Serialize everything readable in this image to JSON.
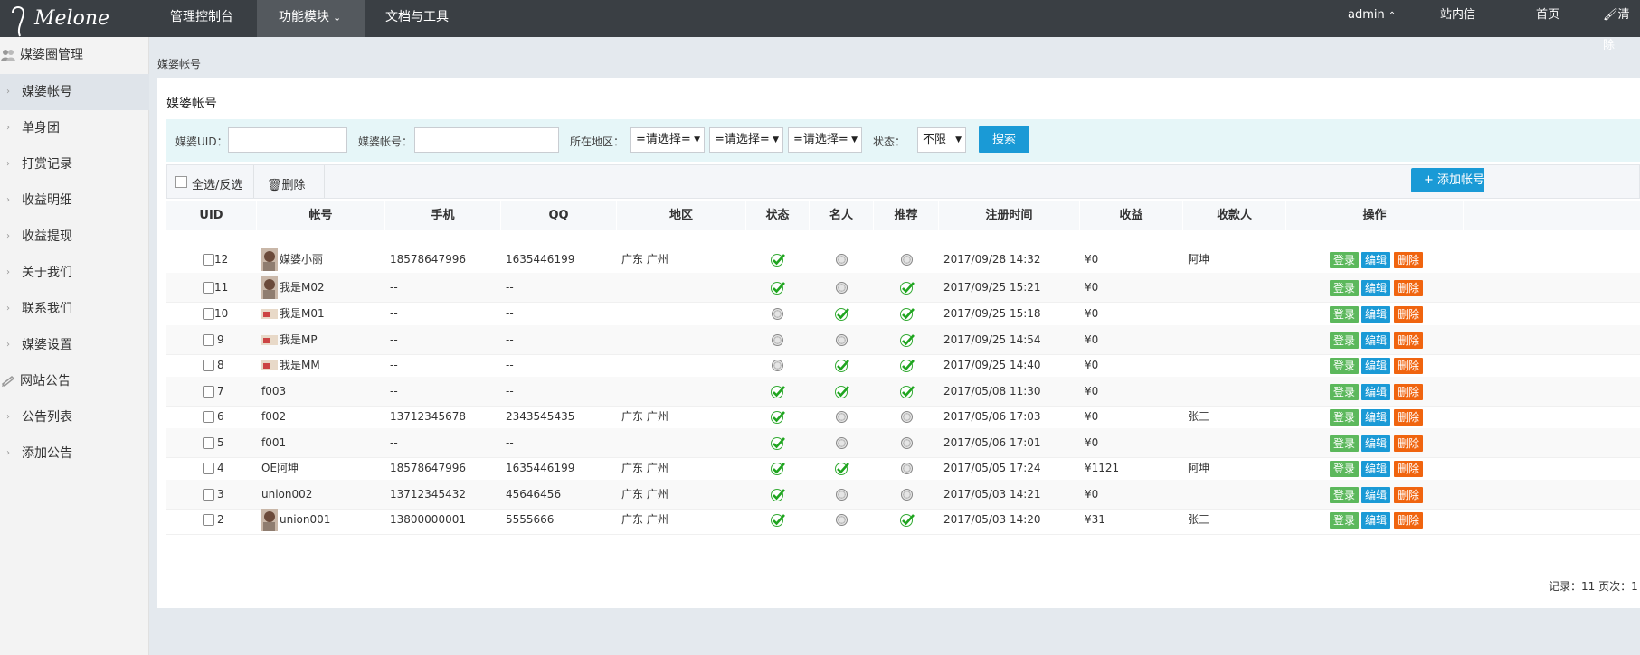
{
  "brand": {
    "logo_text": "Melone"
  },
  "topnav": {
    "items": [
      "管理控制台",
      "功能模块",
      "文档与工具"
    ],
    "user": "admin",
    "messages": "站内信",
    "home": "首页",
    "clear": "清除"
  },
  "sidebar": {
    "group1": "媒婆圈管理",
    "group1_items": [
      "媒婆帐号",
      "单身团",
      "打赏记录",
      "收益明细",
      "收益提现",
      "关于我们",
      "联系我们",
      "媒婆设置"
    ],
    "group2": "网站公告",
    "group2_items": [
      "公告列表",
      "添加公告"
    ]
  },
  "breadcrumb": "媒婆帐号",
  "panel_title": "媒婆帐号",
  "filter": {
    "uid_label": "媒婆UID：",
    "account_label": "媒婆帐号：",
    "region_label": "所在地区：",
    "select_default": "=请选择=",
    "status_label": "状态：",
    "status_value": "不限",
    "search_button": "搜索"
  },
  "toolbar": {
    "select_all": "全选/反选",
    "delete": "删除",
    "add": "+ 添加帐号"
  },
  "table": {
    "headers": [
      "UID",
      "帐号",
      "手机",
      "QQ",
      "地区",
      "状态",
      "名人",
      "推荐",
      "注册时间",
      "收益",
      "收款人",
      "操作"
    ],
    "action_labels": {
      "login": "登录",
      "edit": "编辑",
      "delete": "删除"
    },
    "rows": [
      {
        "uid": "12",
        "account": "媒婆小丽",
        "avatar": "photo",
        "phone": "18578647996",
        "qq": "1635446199",
        "region": "广东 广州",
        "status": true,
        "celebrity": false,
        "recommend": false,
        "time": "2017/09/28 14:32",
        "income": "¥0",
        "payee": "阿坤"
      },
      {
        "uid": "11",
        "account": "我是M02",
        "avatar": "photo",
        "phone": "--",
        "qq": "--",
        "region": "",
        "status": true,
        "celebrity": false,
        "recommend": true,
        "time": "2017/09/25 15:21",
        "income": "¥0",
        "payee": ""
      },
      {
        "uid": "10",
        "account": "我是M01",
        "avatar": "thumb",
        "phone": "--",
        "qq": "--",
        "region": "",
        "status": false,
        "celebrity": true,
        "recommend": true,
        "time": "2017/09/25 15:18",
        "income": "¥0",
        "payee": ""
      },
      {
        "uid": "9",
        "account": "我是MP",
        "avatar": "thumb",
        "phone": "--",
        "qq": "--",
        "region": "",
        "status": false,
        "celebrity": false,
        "recommend": true,
        "time": "2017/09/25 14:54",
        "income": "¥0",
        "payee": ""
      },
      {
        "uid": "8",
        "account": "我是MM",
        "avatar": "thumb",
        "phone": "--",
        "qq": "--",
        "region": "",
        "status": false,
        "celebrity": true,
        "recommend": true,
        "time": "2017/09/25 14:40",
        "income": "¥0",
        "payee": ""
      },
      {
        "uid": "7",
        "account": "f003",
        "avatar": "",
        "phone": "--",
        "qq": "--",
        "region": "",
        "status": true,
        "celebrity": true,
        "recommend": true,
        "time": "2017/05/08 11:30",
        "income": "¥0",
        "payee": ""
      },
      {
        "uid": "6",
        "account": "f002",
        "avatar": "",
        "phone": "13712345678",
        "qq": "2343545435",
        "region": "广东 广州",
        "status": true,
        "celebrity": false,
        "recommend": false,
        "time": "2017/05/06 17:03",
        "income": "¥0",
        "payee": "张三"
      },
      {
        "uid": "5",
        "account": "f001",
        "avatar": "",
        "phone": "--",
        "qq": "--",
        "region": "",
        "status": true,
        "celebrity": false,
        "recommend": false,
        "time": "2017/05/06 17:01",
        "income": "¥0",
        "payee": ""
      },
      {
        "uid": "4",
        "account": "OE阿坤",
        "avatar": "",
        "phone": "18578647996",
        "qq": "1635446199",
        "region": "广东 广州",
        "status": true,
        "celebrity": true,
        "recommend": false,
        "time": "2017/05/05 17:24",
        "income": "¥1121",
        "payee": "阿坤"
      },
      {
        "uid": "3",
        "account": "union002",
        "avatar": "",
        "phone": "13712345432",
        "qq": "45646456",
        "region": "广东 广州",
        "status": true,
        "celebrity": false,
        "recommend": false,
        "time": "2017/05/03 14:21",
        "income": "¥0",
        "payee": ""
      },
      {
        "uid": "2",
        "account": "union001",
        "avatar": "photo",
        "phone": "13800000001",
        "qq": "5555666",
        "region": "广东 广州",
        "status": true,
        "celebrity": false,
        "recommend": true,
        "time": "2017/05/03 14:20",
        "income": "¥31",
        "payee": "张三"
      }
    ]
  },
  "pager": "记录：11   页次：1"
}
